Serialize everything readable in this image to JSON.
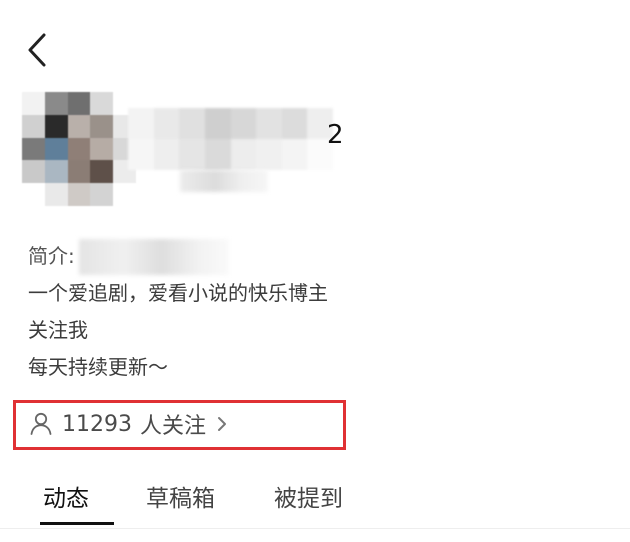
{
  "header": {
    "back_icon": "chevron-left-icon"
  },
  "profile": {
    "username_visible_suffix": "2",
    "avatar_mosaic": [
      [
        "#f2f2f2",
        "#8a8a8a",
        "#6f6f6f",
        "#d9d9d9",
        "#ffffff"
      ],
      [
        "#d0d0d0",
        "#2a2a2a",
        "#b9b0aa",
        "#9a918a",
        "#e8e8e8"
      ],
      [
        "#7a7a7a",
        "#5f7f9a",
        "#8f7f77",
        "#b6aca5",
        "#d8d8d8"
      ],
      [
        "#c9c9c9",
        "#aab7c2",
        "#8b7d75",
        "#5e5049",
        "#ececec"
      ],
      [
        "#ffffff",
        "#e9e9e9",
        "#cfcac6",
        "#d3d3d3",
        "#ffffff"
      ]
    ],
    "name_mosaic": [
      [
        "#f3f3f3",
        "#e9e9e9",
        "#e0e0e0",
        "#cfcfcf",
        "#d7d7d7",
        "#e2e2e2",
        "#dcdcdc",
        "#eeeeee"
      ],
      [
        "#f6f6f6",
        "#eeeeee",
        "#e5e5e5",
        "#dadada",
        "#ededed",
        "#f0f0f0",
        "#f4f4f4",
        "#fbfbfb"
      ]
    ]
  },
  "intro": {
    "label": "简介:",
    "lines": [
      "一个爱追剧，爱看小说的快乐博主",
      "关注我",
      "每天持续更新～"
    ]
  },
  "followers": {
    "count": "11293",
    "label": "人关注",
    "icon": "user-icon",
    "highlight_color": "#e03134"
  },
  "tabs": [
    {
      "label": "动态",
      "active": true
    },
    {
      "label": "草稿箱",
      "active": false
    },
    {
      "label": "被提到",
      "active": false
    }
  ]
}
